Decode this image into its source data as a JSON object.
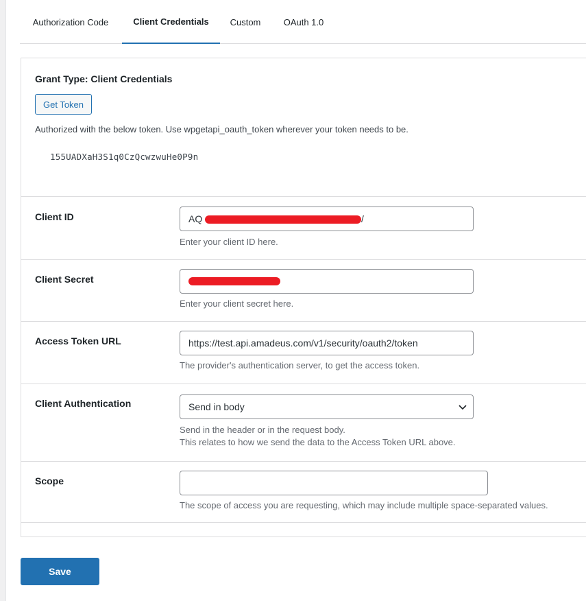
{
  "tabs": [
    {
      "label": "Authorization Code",
      "active": false
    },
    {
      "label": "Client Credentials",
      "active": true
    },
    {
      "label": "Custom",
      "active": false
    },
    {
      "label": "OAuth 1.0",
      "active": false
    }
  ],
  "grant": {
    "title": "Grant Type: Client Credentials",
    "get_token_label": "Get Token",
    "authorized_message": "Authorized with the below token. Use wpgetapi_oauth_token wherever your token needs to be.",
    "token": "155UADXaH3S1q0CzQcwzwuHe0P9n"
  },
  "fields": {
    "client_id": {
      "label": "Client ID",
      "value_prefix": "AQ",
      "value_suffix": "/",
      "description": "Enter your client ID here."
    },
    "client_secret": {
      "label": "Client Secret",
      "value": "",
      "description": "Enter your client secret here."
    },
    "access_token_url": {
      "label": "Access Token URL",
      "value": "https://test.api.amadeus.com/v1/security/oauth2/token",
      "description": "The provider's authentication server, to get the access token."
    },
    "client_authentication": {
      "label": "Client Authentication",
      "selected": "Send in body",
      "description_line1": "Send in the header or in the request body.",
      "description_line2": "This relates to how we send the data to the Access Token URL above."
    },
    "scope": {
      "label": "Scope",
      "value": "",
      "description": "The scope of access you are requesting, which may include multiple space-separated values."
    }
  },
  "save_label": "Save",
  "colors": {
    "accent": "#2271b1",
    "redaction": "#ec1c24",
    "border": "#dcdcde"
  }
}
